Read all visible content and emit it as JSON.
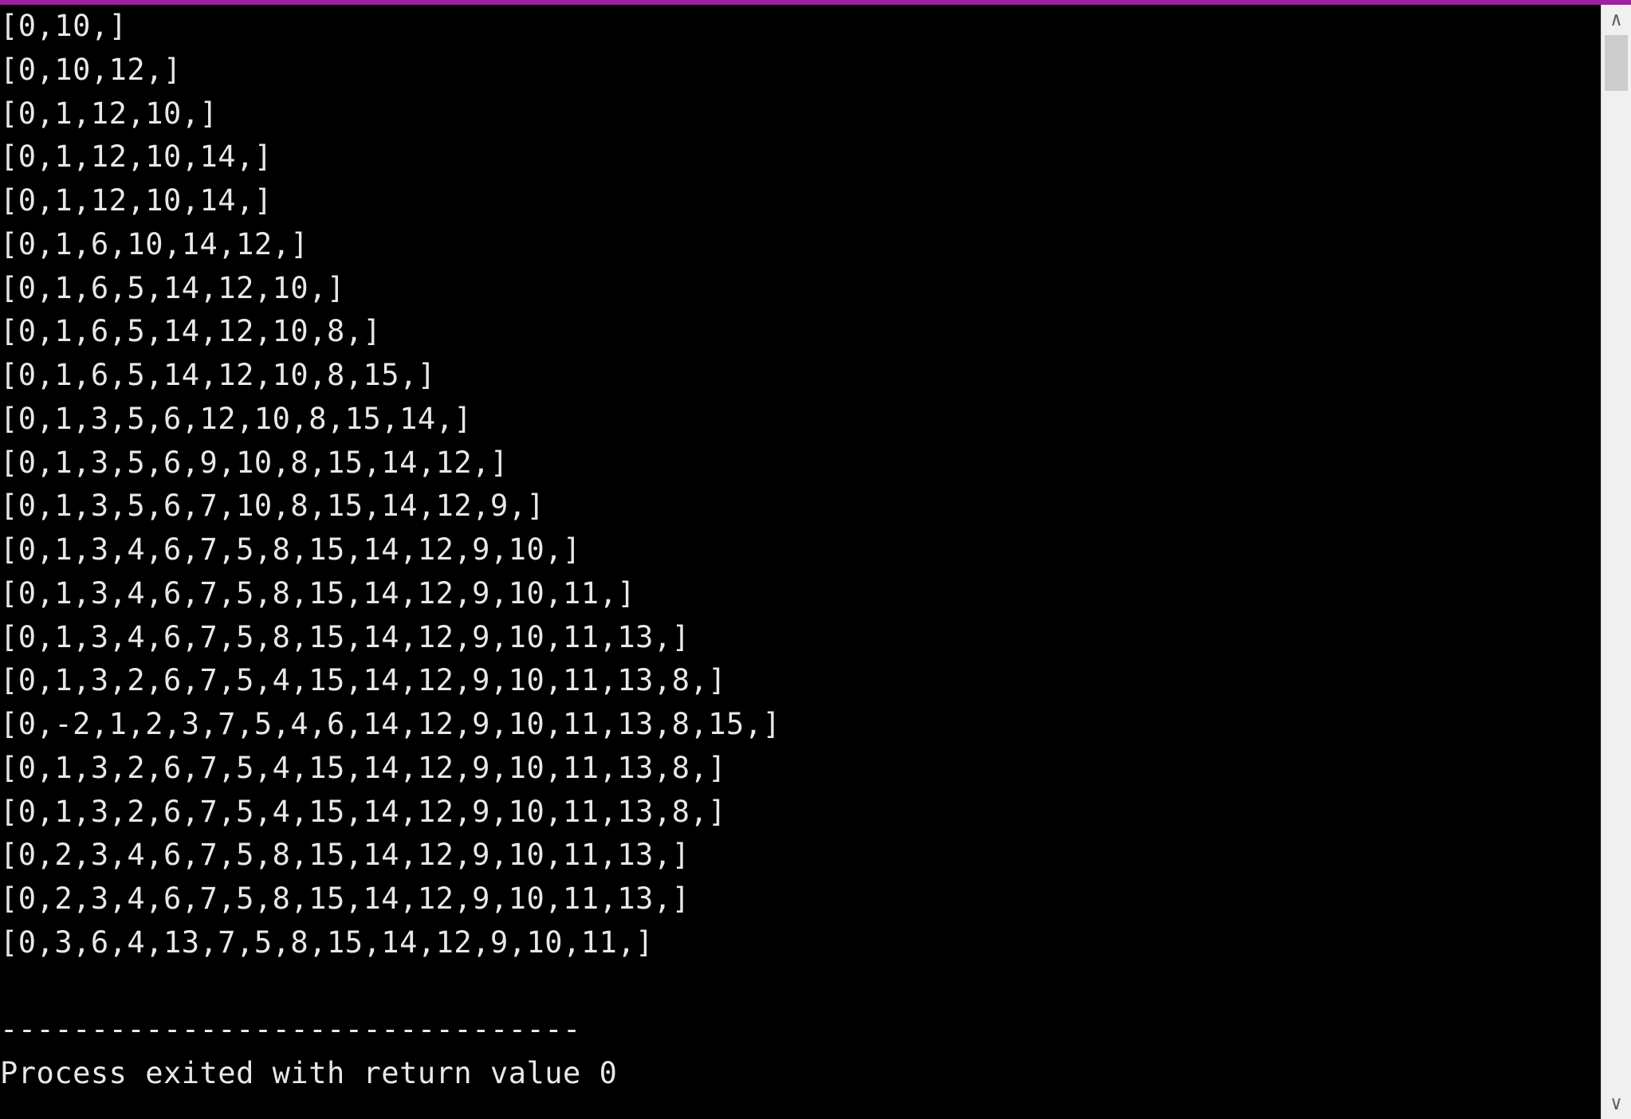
{
  "titlebar": {
    "accent_color": "#a020a0"
  },
  "console": {
    "lines": [
      "[0,10,]",
      "[0,10,12,]",
      "[0,1,12,10,]",
      "[0,1,12,10,14,]",
      "[0,1,12,10,14,]",
      "[0,1,6,10,14,12,]",
      "[0,1,6,5,14,12,10,]",
      "[0,1,6,5,14,12,10,8,]",
      "[0,1,6,5,14,12,10,8,15,]",
      "[0,1,3,5,6,12,10,8,15,14,]",
      "[0,1,3,5,6,9,10,8,15,14,12,]",
      "[0,1,3,5,6,7,10,8,15,14,12,9,]",
      "[0,1,3,4,6,7,5,8,15,14,12,9,10,]",
      "[0,1,3,4,6,7,5,8,15,14,12,9,10,11,]",
      "[0,1,3,4,6,7,5,8,15,14,12,9,10,11,13,]",
      "[0,1,3,2,6,7,5,4,15,14,12,9,10,11,13,8,]",
      "[0,-2,1,2,3,7,5,4,6,14,12,9,10,11,13,8,15,]",
      "[0,1,3,2,6,7,5,4,15,14,12,9,10,11,13,8,]",
      "[0,1,3,2,6,7,5,4,15,14,12,9,10,11,13,8,]",
      "[0,2,3,4,6,7,5,8,15,14,12,9,10,11,13,]",
      "[0,2,3,4,6,7,5,8,15,14,12,9,10,11,13,]",
      "[0,3,6,4,13,7,5,8,15,14,12,9,10,11,]",
      "",
      "--------------------------------",
      "Process exited with return value 0"
    ]
  },
  "scrollbar": {
    "up_glyph": "∧",
    "down_glyph": "∨"
  }
}
